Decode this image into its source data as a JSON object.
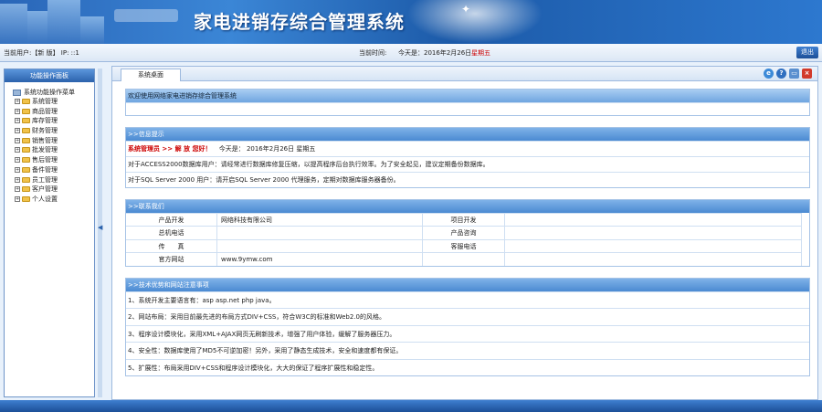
{
  "app": {
    "title": "家电进销存综合管理系统"
  },
  "infobar": {
    "user_label": "当前用户:【新 版】 IP: ::1",
    "time_label": "当前时间:",
    "date_text": "今天是：2016年2月26日",
    "weekday": "星期五",
    "exit_label": "退出"
  },
  "sidebar": {
    "title": "功能操作面板",
    "root_label": "系统功能操作菜单",
    "items": [
      {
        "label": "系统管理"
      },
      {
        "label": "商品管理"
      },
      {
        "label": "库存管理"
      },
      {
        "label": "财务管理"
      },
      {
        "label": "销售管理"
      },
      {
        "label": "批发管理"
      },
      {
        "label": "售后管理"
      },
      {
        "label": "备件管理"
      },
      {
        "label": "员工管理"
      },
      {
        "label": "客户管理"
      },
      {
        "label": "个人设置"
      }
    ]
  },
  "tabs": {
    "active": "系统桌面"
  },
  "welcome": {
    "text": "欢迎使用网络家电进销存综合管理系统"
  },
  "tips": {
    "header": ">>信息提示",
    "greeting_red": "系统管理员 >> 解 放 您好！",
    "greeting_date": "今天是： 2016年2月26日 星期五",
    "line1": "对于ACCESS2000数据库用户：请经常进行数据库修复压缩，以提高程序后台执行效率。为了安全起见，建议定期备份数据库。",
    "line2": "对于SQL Server 2000 用户：请开启SQL Server 2000 代理服务，定期对数据库服务器备份。"
  },
  "contact": {
    "header": ">>联系我们",
    "rows": [
      {
        "label1": "产品开发",
        "value1": "网络科技有限公司",
        "label2": "项目开发",
        "value2": ""
      },
      {
        "label1": "总机电话",
        "value1": "",
        "label2": "产品咨询",
        "value2": ""
      },
      {
        "label1": "传　　真",
        "value1": "",
        "label2": "客服电话",
        "value2": ""
      },
      {
        "label1": "官方网站",
        "value1": "www.9ymw.com",
        "label2": "",
        "value2": ""
      }
    ]
  },
  "tech": {
    "header": ">>技术优势和网站注意事项",
    "items": [
      "1、系统开发主要语言有：asp asp.net php java。",
      "2、网站布局：采用目前最先进的布局方式DIV+CSS，符合W3C的标准和Web2.0的风格。",
      "3、程序设计模块化，采用XML+AJAX网页无刷新技术，增强了用户体验，缓解了服务器压力。",
      "4、安全性：数据库使用了MD5不可逆加密！另外，采用了静态生成技术，安全和速度都有保证。",
      "5、扩展性：布局采用DIV+CSS和程序设计模块化，大大的保证了程序扩展性和稳定性。"
    ]
  },
  "colors": {
    "banner": "#2a66b8",
    "section_header": "#4b8ad2",
    "accent_red": "#cc0000"
  }
}
